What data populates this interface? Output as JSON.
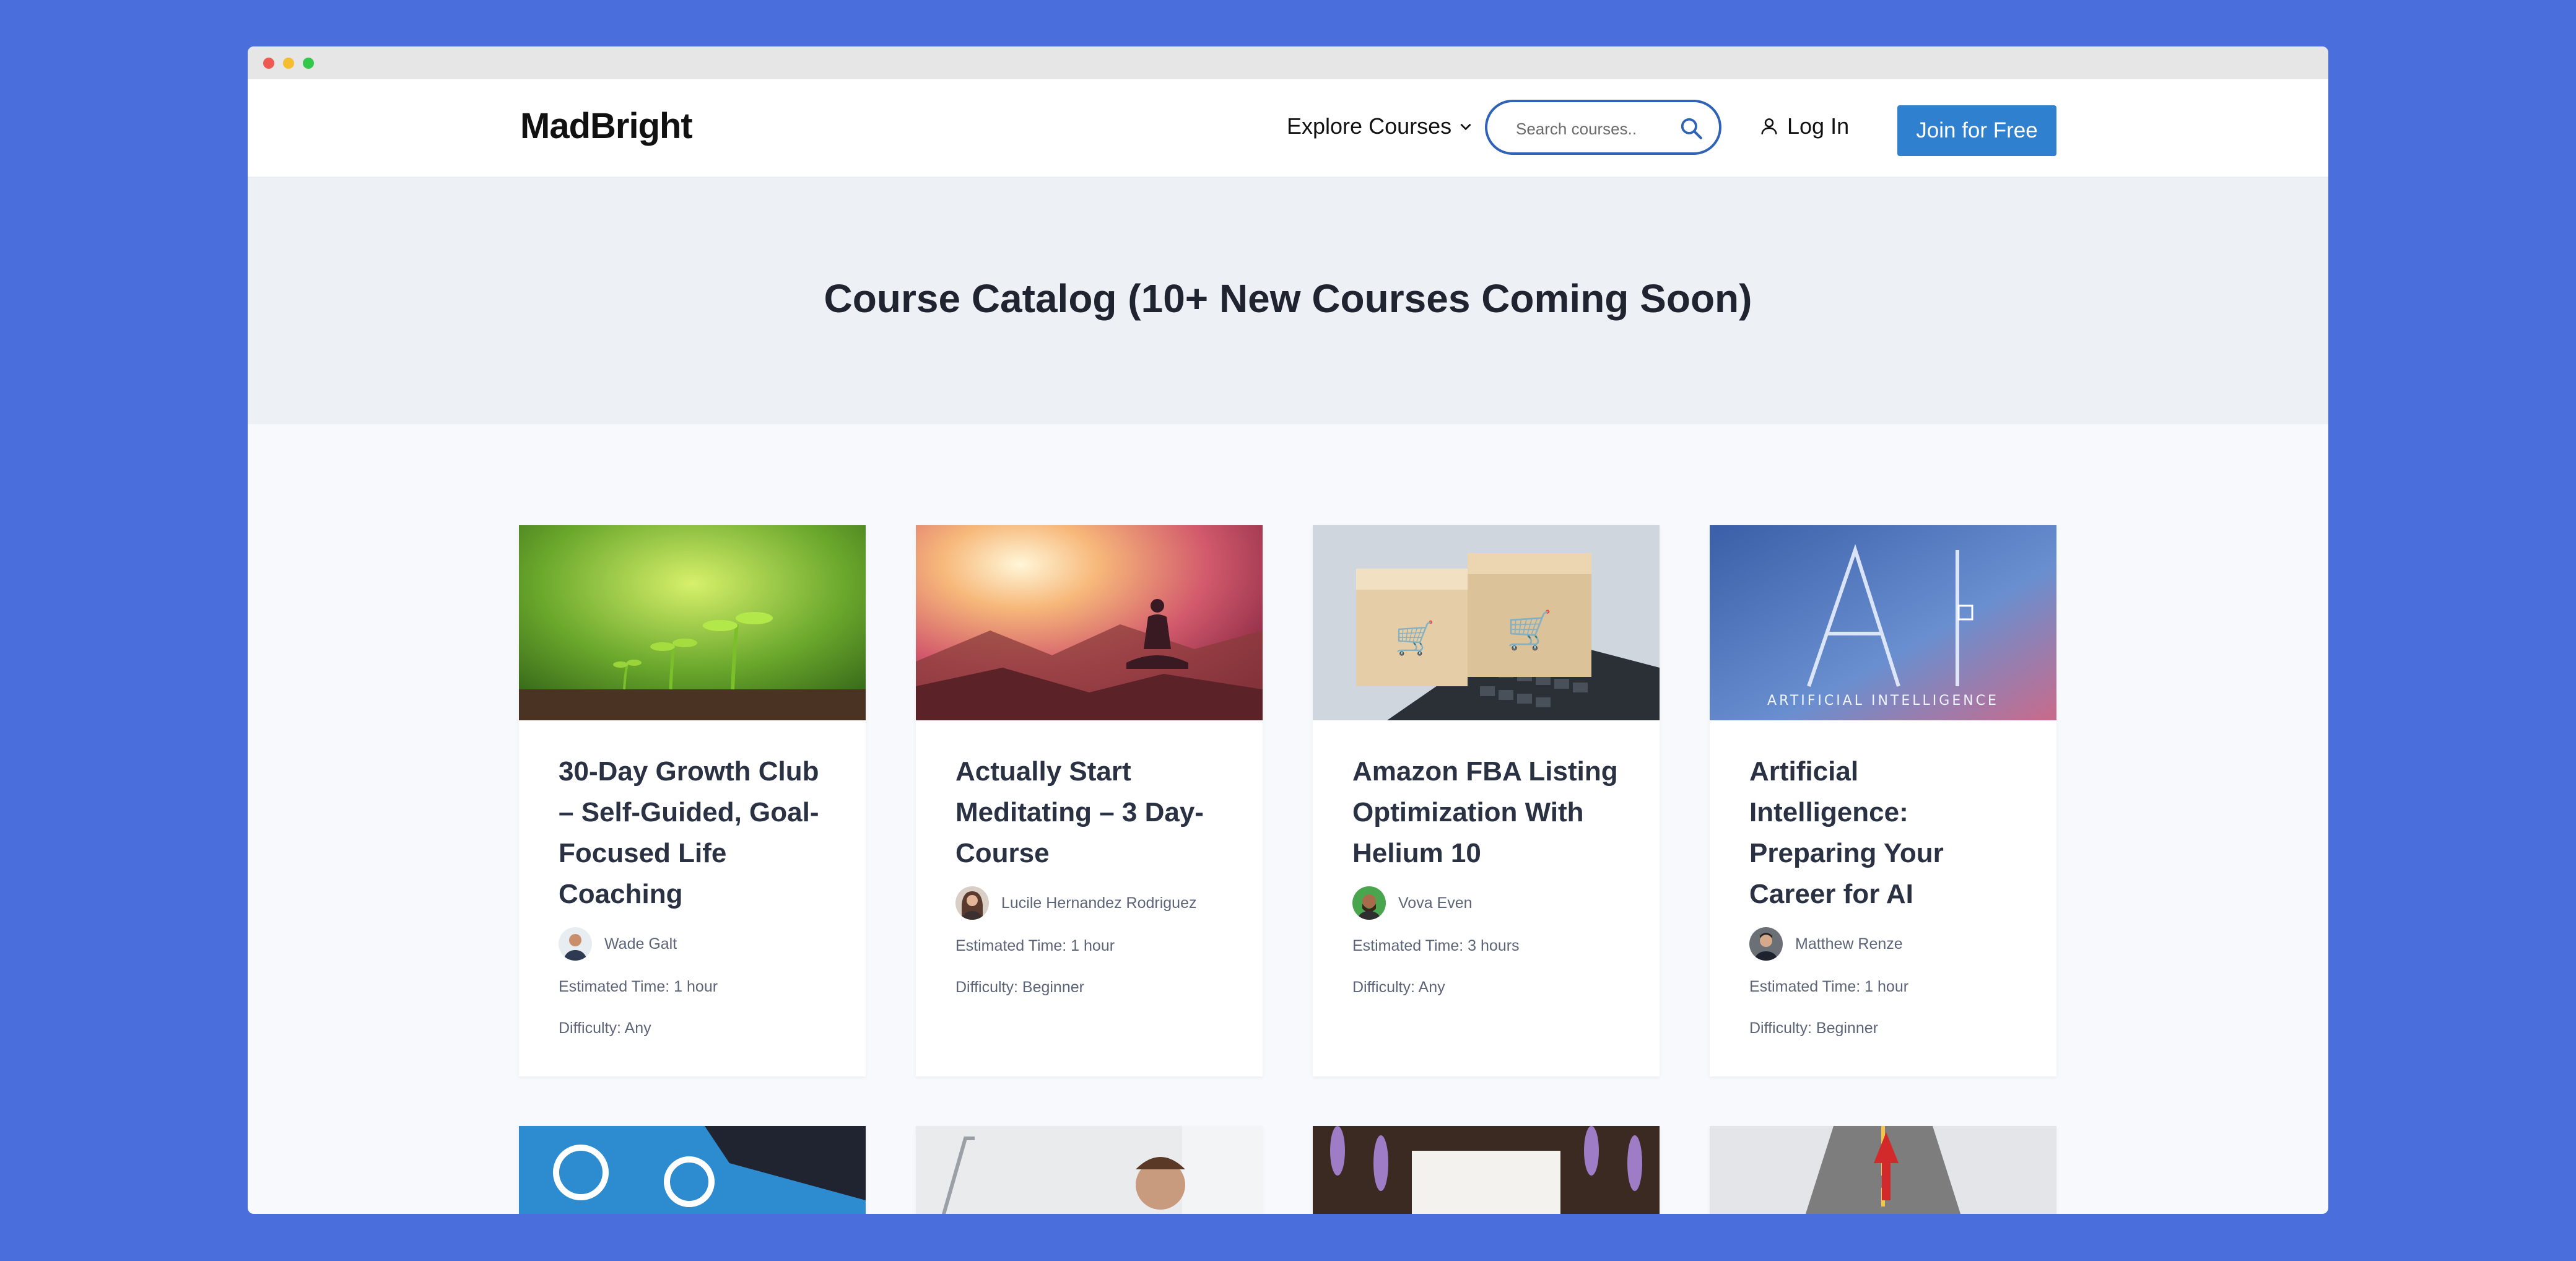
{
  "brand": {
    "name": "MadBright"
  },
  "nav": {
    "explore_label": "Explore Courses",
    "search_placeholder": "Search courses..",
    "login_label": "Log In",
    "join_label": "Join for Free"
  },
  "hero": {
    "title": "Course Catalog (10+ New Courses Coming Soon)"
  },
  "courses": [
    {
      "title": "30-Day Growth Club – Self-Guided, Goal-Focused Life Coaching",
      "author": "Wade Galt",
      "time": "Estimated Time: 1 hour",
      "difficulty": "Difficulty: Any"
    },
    {
      "title": "Actually Start Meditating – 3 Day-Course",
      "author": "Lucile Hernandez Rodriguez",
      "time": "Estimated Time: 1 hour",
      "difficulty": "Difficulty: Beginner"
    },
    {
      "title": "Amazon FBA Listing Optimization With Helium 10",
      "author": "Vova Even",
      "time": "Estimated Time: 3 hours",
      "difficulty": "Difficulty: Any"
    },
    {
      "title": "Artificial Intelligence: Preparing Your Career for AI",
      "author": "Matthew Renze",
      "time": "Estimated Time: 1 hour",
      "difficulty": "Difficulty: Beginner"
    }
  ],
  "thumb_text": {
    "ai_caption": "ARTIFICIAL INTELLIGENCE"
  },
  "colors": {
    "background": "#4a6fdc",
    "accent": "#2f80cf",
    "hero": "#edf1f6"
  }
}
